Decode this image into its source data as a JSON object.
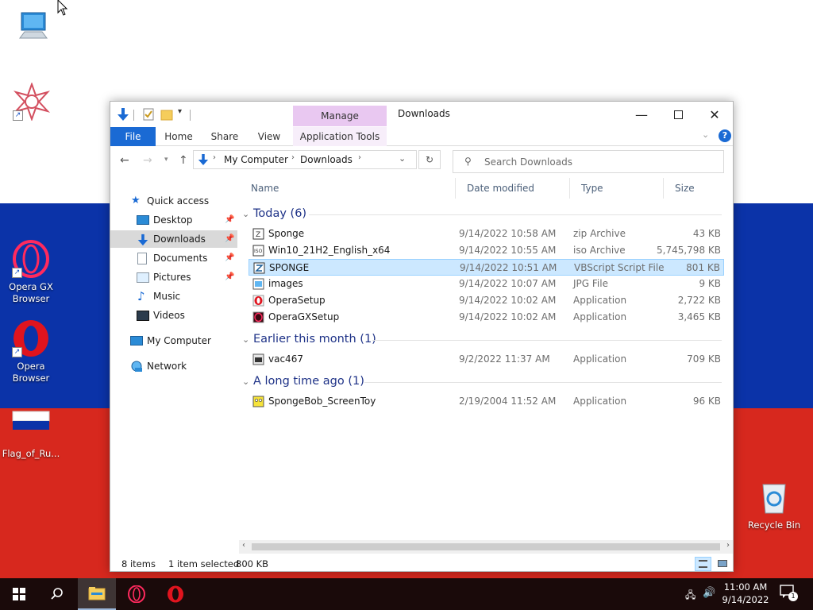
{
  "desktop": {
    "icons": [
      {
        "label": ""
      },
      {
        "label": ""
      },
      {
        "label": "Opera GX\nBrowser"
      },
      {
        "label": "Opera\nBrowser"
      },
      {
        "label": "Flag_of_Ru..."
      },
      {
        "label": "Recycle Bin"
      }
    ]
  },
  "window": {
    "title": "Downloads",
    "manage_tab": "Manage",
    "ribbon": {
      "file": "File",
      "home": "Home",
      "share": "Share",
      "view": "View",
      "app_tools": "Application Tools"
    },
    "address": {
      "crumbs": [
        "My Computer",
        "Downloads"
      ]
    },
    "search": {
      "placeholder": "Search Downloads"
    },
    "nav": {
      "quick_access": "Quick access",
      "desktop": "Desktop",
      "downloads": "Downloads",
      "documents": "Documents",
      "pictures": "Pictures",
      "music": "Music",
      "videos": "Videos",
      "my_computer": "My Computer",
      "network": "Network"
    },
    "columns": {
      "name": "Name",
      "date": "Date modified",
      "type": "Type",
      "size": "Size"
    },
    "groups": [
      {
        "label": "Today (6)",
        "files": [
          {
            "name": "Sponge",
            "date": "9/14/2022 10:58 AM",
            "type": "zip Archive",
            "size": "43 KB"
          },
          {
            "name": "Win10_21H2_English_x64",
            "date": "9/14/2022 10:55 AM",
            "type": "iso Archive",
            "size": "5,745,798 KB"
          },
          {
            "name": "SPONGE",
            "date": "9/14/2022 10:51 AM",
            "type": "VBScript Script File",
            "size": "801 KB"
          },
          {
            "name": "images",
            "date": "9/14/2022 10:07 AM",
            "type": "JPG File",
            "size": "9 KB"
          },
          {
            "name": "OperaSetup",
            "date": "9/14/2022 10:02 AM",
            "type": "Application",
            "size": "2,722 KB"
          },
          {
            "name": "OperaGXSetup",
            "date": "9/14/2022 10:02 AM",
            "type": "Application",
            "size": "3,465 KB"
          }
        ]
      },
      {
        "label": "Earlier this month (1)",
        "files": [
          {
            "name": "vac467",
            "date": "9/2/2022 11:37 AM",
            "type": "Application",
            "size": "709 KB"
          }
        ]
      },
      {
        "label": "A long time ago (1)",
        "files": [
          {
            "name": "SpongeBob_ScreenToy",
            "date": "2/19/2004 11:52 AM",
            "type": "Application",
            "size": "96 KB"
          }
        ]
      }
    ],
    "status": {
      "items": "8 items",
      "selected": "1 item selected",
      "sel_size": "800 KB"
    }
  },
  "taskbar": {
    "time": "11:00 AM",
    "date": "9/14/2022",
    "notification_count": "1"
  },
  "colors": {
    "file_tab": "#1a6ad4",
    "selection": "#cce8ff",
    "manage": "#e9c8f1",
    "group_text": "#1e3287"
  }
}
